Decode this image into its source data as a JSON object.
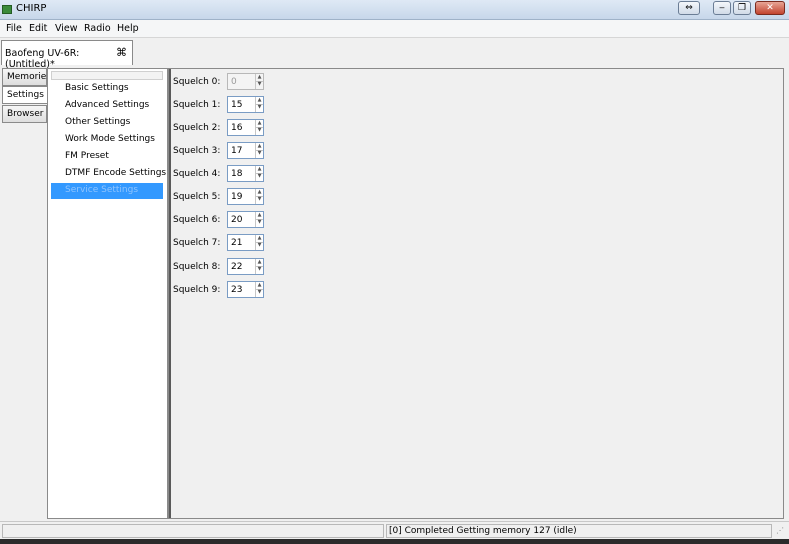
{
  "window": {
    "title": "CHIRP"
  },
  "titlebar_buttons": [
    "⇔",
    "‒",
    "❐",
    "✕"
  ],
  "menu": [
    "File",
    "Edit",
    "View",
    "Radio",
    "Help"
  ],
  "doc_tab": {
    "label": "Baofeng UV-6R: (Untitled)*",
    "close_icon": "⌘"
  },
  "side_tabs": [
    "Memories",
    "Settings",
    "Browser"
  ],
  "settings_nav": {
    "items": [
      "Basic Settings",
      "Advanced Settings",
      "Other Settings",
      "Work Mode Settings",
      "FM Preset",
      "DTMF Encode Settings",
      "Service Settings"
    ],
    "selected": "Service Settings"
  },
  "squelch": [
    {
      "label": "Squelch 0:",
      "value": "0",
      "enabled": false
    },
    {
      "label": "Squelch 1:",
      "value": "15",
      "enabled": true
    },
    {
      "label": "Squelch 2:",
      "value": "16",
      "enabled": true
    },
    {
      "label": "Squelch 3:",
      "value": "17",
      "enabled": true
    },
    {
      "label": "Squelch 4:",
      "value": "18",
      "enabled": true
    },
    {
      "label": "Squelch 5:",
      "value": "19",
      "enabled": true
    },
    {
      "label": "Squelch 6:",
      "value": "20",
      "enabled": true
    },
    {
      "label": "Squelch 7:",
      "value": "21",
      "enabled": true
    },
    {
      "label": "Squelch 8:",
      "value": "22",
      "enabled": true
    },
    {
      "label": "Squelch 9:",
      "value": "23",
      "enabled": true
    }
  ],
  "status": {
    "left": "",
    "right": "[0] Completed Getting memory 127 (idle)"
  },
  "colors": {
    "selection": "#3399ff",
    "titlebar": "#c7d7ea"
  }
}
